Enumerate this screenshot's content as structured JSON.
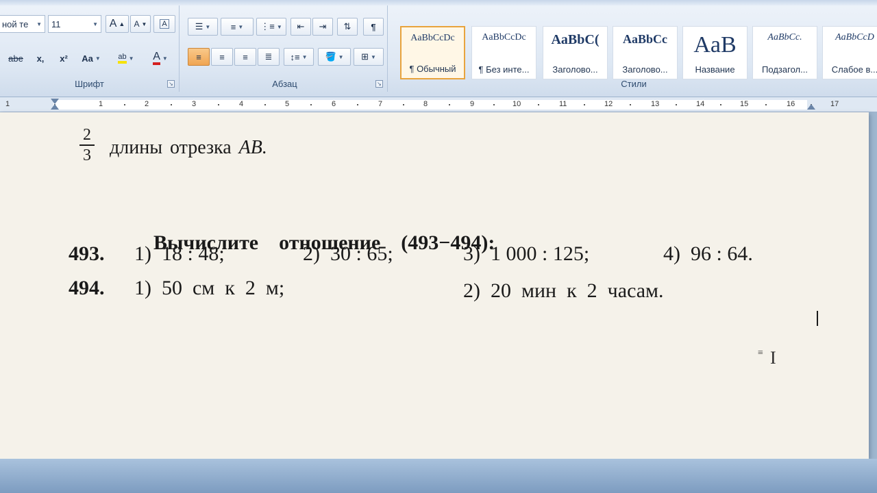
{
  "ribbon": {
    "font_group": {
      "label": "Шрифт",
      "font_name": "ной те",
      "font_size": "11",
      "grow_label": "A",
      "shrink_label": "A",
      "clear_label": "A",
      "strike_label": "abe",
      "subscript_label": "x,",
      "superscript_label": "x²",
      "case_label": "Aa",
      "highlight_label": "ab",
      "color_label": "A"
    },
    "paragraph_group": {
      "label": "Абзац",
      "pilcrow": "¶"
    },
    "styles_group": {
      "label": "Стили",
      "items": [
        {
          "sample": "AaBbCcDc",
          "name": "¶ Обычный"
        },
        {
          "sample": "AaBbCcDc",
          "name": "¶ Без инте..."
        },
        {
          "sample": "AaBbC(",
          "name": "Заголово..."
        },
        {
          "sample": "AaBbCc",
          "name": "Заголово..."
        },
        {
          "sample": "AaB",
          "name": "Название"
        },
        {
          "sample": "AaBbCc.",
          "name": "Подзагол..."
        },
        {
          "sample": "AaBbCcD",
          "name": "Слабое в..."
        }
      ]
    },
    "colors": {
      "accent_orange": "#e8a33c",
      "font_red": "#d42020",
      "highlight_yellow": "#f5e20a"
    }
  },
  "ruler": {
    "numbers": [
      "1",
      "1",
      "2",
      "3",
      "4",
      "5",
      "6",
      "7",
      "8",
      "9",
      "10",
      "11",
      "12",
      "13",
      "14",
      "15",
      "16",
      "17"
    ]
  },
  "document": {
    "fraction": {
      "numerator": "2",
      "denominator": "3"
    },
    "line1_text": "длины  отрезка",
    "line1_var": "AB.",
    "heading_prefix": "Вычислите    отношение    ",
    "heading_range": "(493−494)",
    "heading_suffix": ":",
    "problems": [
      {
        "number": "493.",
        "items": [
          "1)  18 : 48;",
          "2)  30 : 65;",
          "3)  1 000 : 125;",
          "4)  96 : 64."
        ]
      },
      {
        "number": "494.",
        "items": [
          "1)  50  см  к  2  м;",
          "2)  20  мин  к  2  часам."
        ]
      }
    ],
    "paragraph_mark": "≡"
  }
}
